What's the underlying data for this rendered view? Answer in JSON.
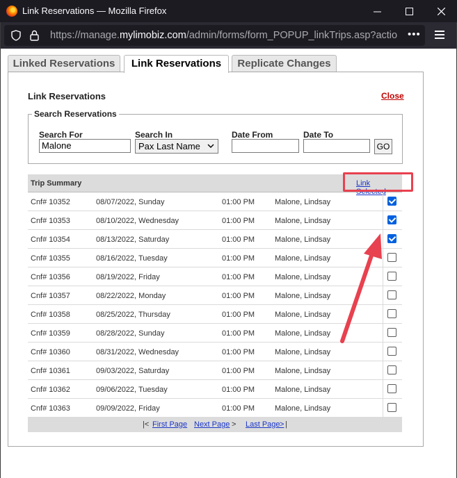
{
  "window": {
    "title": "Link Reservations — Mozilla Firefox"
  },
  "browser": {
    "url_prefix": "https://manage.",
    "url_domain": "mylimobiz.com",
    "url_path": "/admin/forms/form_POPUP_linkTrips.asp?action=sho",
    "more_glyph": "•••"
  },
  "tabs": [
    {
      "label": "Linked Reservations",
      "active": false
    },
    {
      "label": "Link Reservations",
      "active": true
    },
    {
      "label": "Replicate Changes",
      "active": false
    }
  ],
  "panel": {
    "title": "Link Reservations",
    "close_label": "Close"
  },
  "search": {
    "legend": "Search Reservations",
    "search_for_label": "Search For",
    "search_for_value": "Malone",
    "search_in_label": "Search In",
    "search_in_value": "Pax Last Name",
    "date_from_label": "Date From",
    "date_from_value": "",
    "date_to_label": "Date To",
    "date_to_value": "",
    "go_label": "GO"
  },
  "table": {
    "title": "Trip Summary",
    "link_selected_label": "Link Selected",
    "rows": [
      {
        "conf": "Cnf# 10352",
        "date": "08/07/2022, Sunday",
        "time": "01:00 PM",
        "name": "Malone, Lindsay",
        "checked": true
      },
      {
        "conf": "Cnf# 10353",
        "date": "08/10/2022, Wednesday",
        "time": "01:00 PM",
        "name": "Malone, Lindsay",
        "checked": true
      },
      {
        "conf": "Cnf# 10354",
        "date": "08/13/2022, Saturday",
        "time": "01:00 PM",
        "name": "Malone, Lindsay",
        "checked": true
      },
      {
        "conf": "Cnf# 10355",
        "date": "08/16/2022, Tuesday",
        "time": "01:00 PM",
        "name": "Malone, Lindsay",
        "checked": false
      },
      {
        "conf": "Cnf# 10356",
        "date": "08/19/2022, Friday",
        "time": "01:00 PM",
        "name": "Malone, Lindsay",
        "checked": false
      },
      {
        "conf": "Cnf# 10357",
        "date": "08/22/2022, Monday",
        "time": "01:00 PM",
        "name": "Malone, Lindsay",
        "checked": false
      },
      {
        "conf": "Cnf# 10358",
        "date": "08/25/2022, Thursday",
        "time": "01:00 PM",
        "name": "Malone, Lindsay",
        "checked": false
      },
      {
        "conf": "Cnf# 10359",
        "date": "08/28/2022, Sunday",
        "time": "01:00 PM",
        "name": "Malone, Lindsay",
        "checked": false
      },
      {
        "conf": "Cnf# 10360",
        "date": "08/31/2022, Wednesday",
        "time": "01:00 PM",
        "name": "Malone, Lindsay",
        "checked": false
      },
      {
        "conf": "Cnf# 10361",
        "date": "09/03/2022, Saturday",
        "time": "01:00 PM",
        "name": "Malone, Lindsay",
        "checked": false
      },
      {
        "conf": "Cnf# 10362",
        "date": "09/06/2022, Tuesday",
        "time": "01:00 PM",
        "name": "Malone, Lindsay",
        "checked": false
      },
      {
        "conf": "Cnf# 10363",
        "date": "09/09/2022, Friday",
        "time": "01:00 PM",
        "name": "Malone, Lindsay",
        "checked": false
      }
    ]
  },
  "pager": {
    "left_bracket": "|<",
    "first_page": "First Page",
    "next_page": "Next Page",
    "next_glyph": ">",
    "last_page": "Last Page",
    "last_glyph": ">",
    "right_bracket": "|"
  },
  "colors": {
    "annotation": "#e8414f",
    "checkbox_on": "#0060df",
    "link": "#1a35c8",
    "close": "#c00000"
  }
}
